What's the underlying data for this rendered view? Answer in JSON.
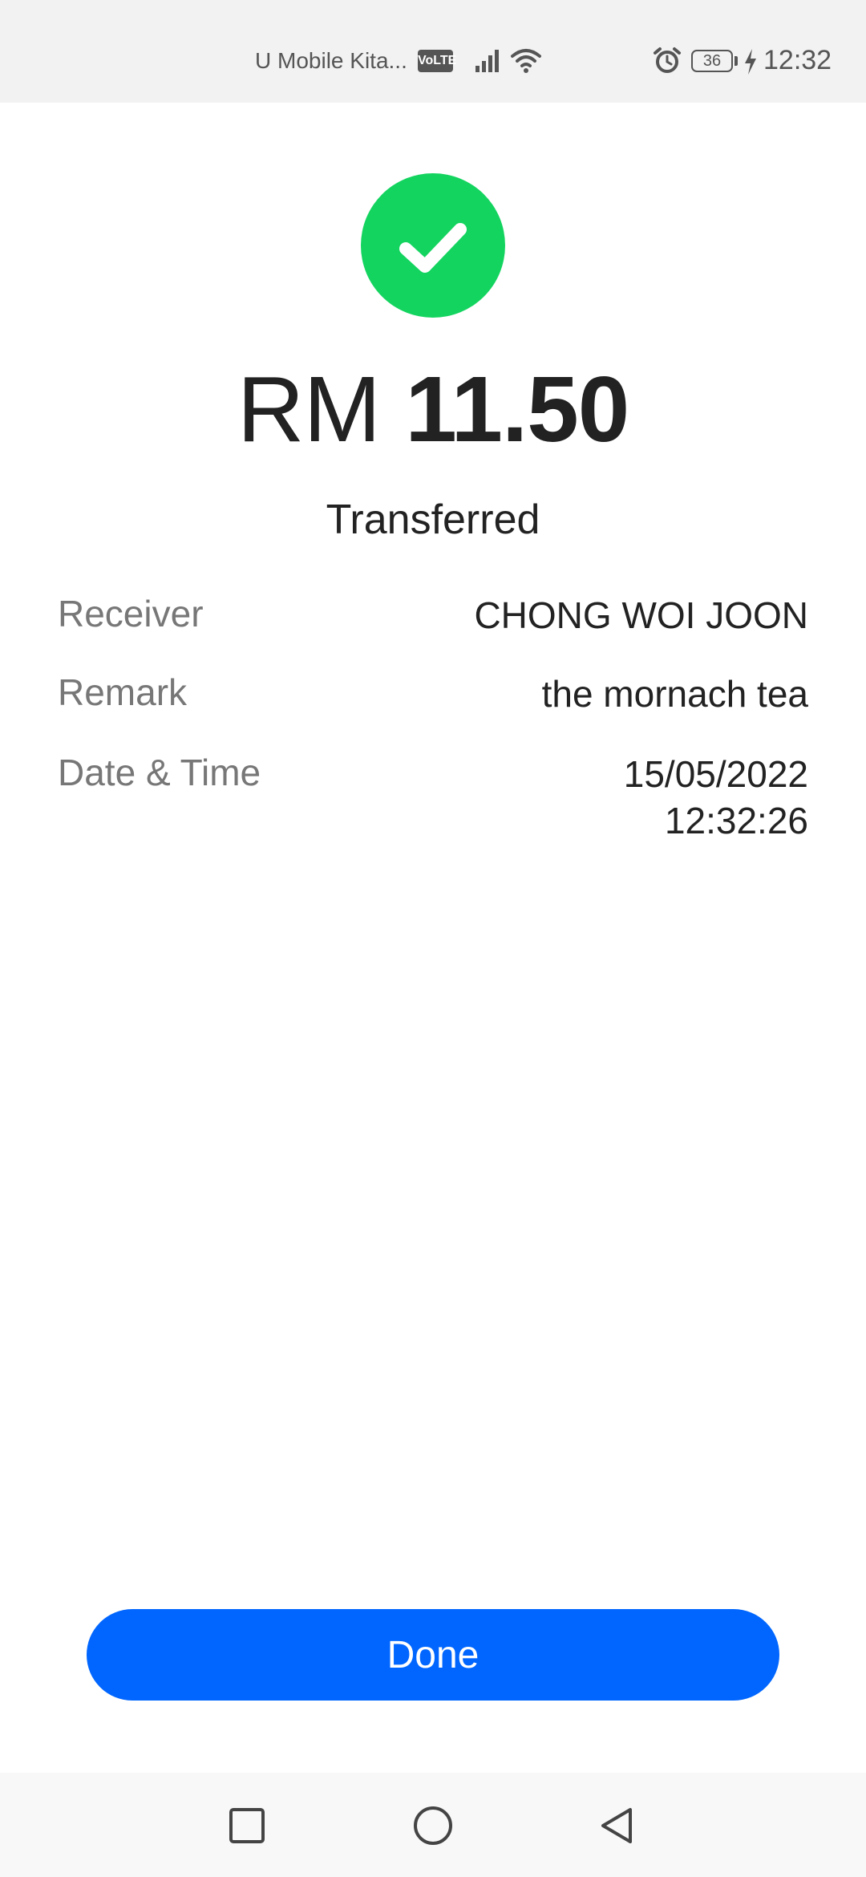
{
  "status_bar": {
    "carrier": "U Mobile Kita...",
    "volte": "VoLTE",
    "battery": "36",
    "time": "12:32"
  },
  "icons": {
    "success": "check-circle-icon",
    "nav_recent": "square-icon",
    "nav_home": "circle-icon",
    "nav_back": "triangle-back-icon"
  },
  "colors": {
    "success": "#13d45f",
    "primary_button": "#0066ff",
    "label": "#777777",
    "text": "#222222"
  },
  "transaction": {
    "currency": "RM",
    "amount": "11.50",
    "status": "Transferred",
    "details": {
      "receiver_label": "Receiver",
      "receiver_value": "CHONG WOI JOON",
      "remark_label": "Remark",
      "remark_value": "the mornach tea",
      "datetime_label": "Date & Time",
      "date_value": "15/05/2022",
      "time_value": "12:32:26"
    }
  },
  "actions": {
    "done_label": "Done"
  }
}
